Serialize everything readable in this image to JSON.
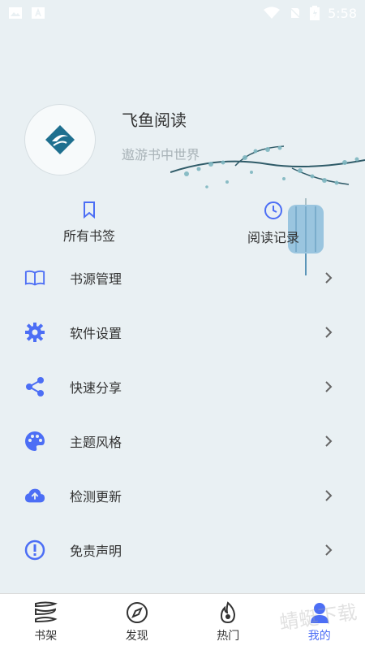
{
  "status_bar": {
    "time": "5:58"
  },
  "profile": {
    "app_name": "飞鱼阅读",
    "slogan": "遨游书中世界"
  },
  "quick_actions": [
    {
      "label": "所有书签",
      "icon": "bookmark-icon"
    },
    {
      "label": "阅读记录",
      "icon": "clock-icon"
    }
  ],
  "menu": [
    {
      "label": "书源管理",
      "icon": "book-open-icon"
    },
    {
      "label": "软件设置",
      "icon": "gear-icon"
    },
    {
      "label": "快速分享",
      "icon": "share-icon"
    },
    {
      "label": "主题风格",
      "icon": "palette-icon"
    },
    {
      "label": "检测更新",
      "icon": "cloud-upload-icon"
    },
    {
      "label": "免责声明",
      "icon": "info-icon"
    }
  ],
  "bottom_nav": [
    {
      "label": "书架",
      "icon": "bookshelf-icon"
    },
    {
      "label": "发现",
      "icon": "compass-icon"
    },
    {
      "label": "热门",
      "icon": "fire-icon"
    },
    {
      "label": "我的",
      "icon": "profile-icon",
      "active": true
    }
  ],
  "watermark_text": "蜻蜓下载",
  "accent_color": "#4c6ef5"
}
